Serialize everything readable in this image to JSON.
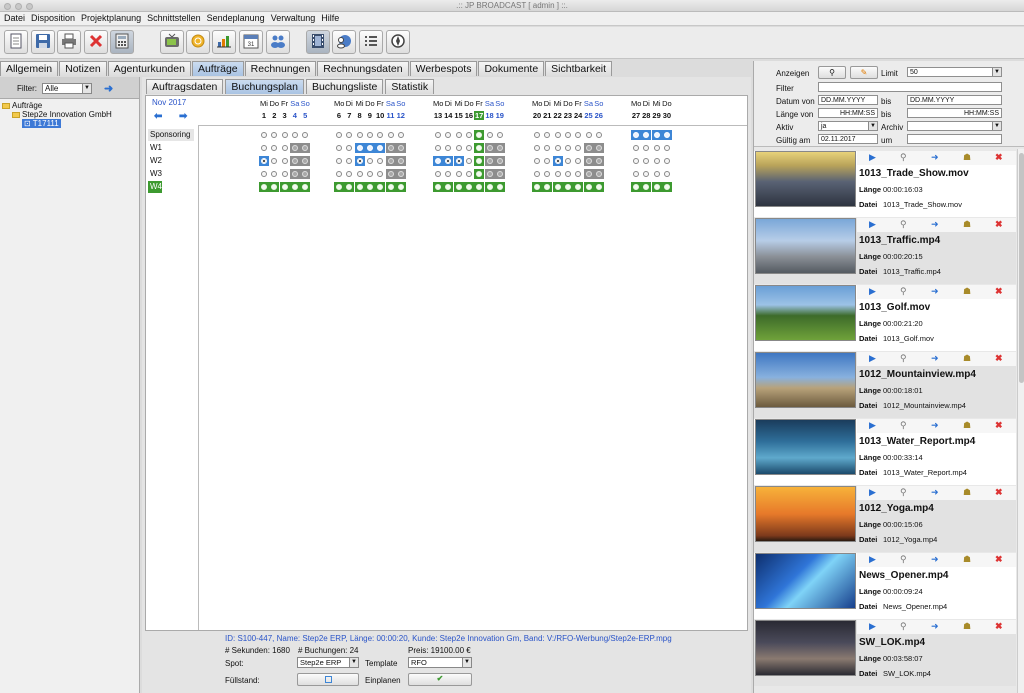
{
  "window": {
    "title": ".:: JP BROADCAST [ admin ] ::."
  },
  "menu": [
    "Datei",
    "Disposition",
    "Projektplanung",
    "Schnittstellen",
    "Sendeplanung",
    "Verwaltung",
    "Hilfe"
  ],
  "toolbar": {
    "buttons": [
      "new-document",
      "save",
      "print",
      "delete",
      "calculator",
      "tv",
      "coins",
      "chart",
      "calendar",
      "users",
      "film",
      "globe-user",
      "list",
      "compass"
    ],
    "active": [
      "calculator",
      "film"
    ]
  },
  "main_tabs": [
    "Allgemein",
    "Notizen",
    "Agenturkunden",
    "Aufträge",
    "Rechnungen",
    "Rechnungsdaten",
    "Werbespots",
    "Dokumente",
    "Sichtbarkeit"
  ],
  "main_tab_active": "Aufträge",
  "left": {
    "filter_label": "Filter:",
    "filter_value": "Alle",
    "tree": {
      "root": "Aufträge",
      "customer": "Step2e Innovation GmbH",
      "order": "T17111"
    }
  },
  "sub_tabs": [
    "Auftragsdaten",
    "Buchungsplan",
    "Buchungsliste",
    "Statistik"
  ],
  "sub_tab_active": "Buchungsplan",
  "plan": {
    "month": "Nov 2017",
    "rows": [
      "Sponsoring",
      "W1",
      "W2",
      "W3",
      "W4"
    ],
    "today": "17",
    "weeks": [
      {
        "days": [
          [
            "Mi",
            "1"
          ],
          [
            "Do",
            "2"
          ],
          [
            "Fr",
            "3"
          ],
          [
            "Sa",
            "4"
          ],
          [
            "So",
            "5"
          ]
        ],
        "cells": [
          "wwwww",
          "wwwgg",
          "bwwgg",
          "wwwgg",
          "GGGGG"
        ],
        "sel": [
          [
            2,
            0
          ]
        ]
      },
      {
        "days": [
          [
            "Mo",
            "6"
          ],
          [
            "Di",
            "7"
          ],
          [
            "Mi",
            "8"
          ],
          [
            "Do",
            "9"
          ],
          [
            "Fr",
            "10"
          ],
          [
            "Sa",
            "11"
          ],
          [
            "So",
            "12"
          ]
        ],
        "cells": [
          "wwwwwww",
          "wwbbbgg",
          "wwbwwgg",
          "wwwwwgg",
          "GGGGGGG"
        ],
        "sel": [
          [
            2,
            2
          ]
        ]
      },
      {
        "days": [
          [
            "Mo",
            "13"
          ],
          [
            "Di",
            "14"
          ],
          [
            "Mi",
            "15"
          ],
          [
            "Do",
            "16"
          ],
          [
            "Fr",
            "17"
          ],
          [
            "Sa",
            "18"
          ],
          [
            "So",
            "19"
          ]
        ],
        "cells": [
          "wwwwGww",
          "wwwwGgg",
          "bbbwGgg",
          "wwwwGgg",
          "GGGGGGG"
        ],
        "sel": [
          [
            2,
            1
          ],
          [
            2,
            2
          ]
        ]
      },
      {
        "days": [
          [
            "Mo",
            "20"
          ],
          [
            "Di",
            "21"
          ],
          [
            "Mi",
            "22"
          ],
          [
            "Do",
            "23"
          ],
          [
            "Fr",
            "24"
          ],
          [
            "Sa",
            "25"
          ],
          [
            "So",
            "26"
          ]
        ],
        "cells": [
          "wwwwwww",
          "wwwwwgg",
          "wwbwwgg",
          "wwwwwgg",
          "GGGGGGG"
        ],
        "sel": [
          [
            2,
            2
          ]
        ]
      },
      {
        "days": [
          [
            "Mo",
            "27"
          ],
          [
            "Di",
            "28"
          ],
          [
            "Mi",
            "29"
          ],
          [
            "Do",
            "30"
          ]
        ],
        "cells": [
          "bbbb",
          "wwww",
          "wwww",
          "wwww",
          "GGGG"
        ],
        "sel": []
      }
    ]
  },
  "info": {
    "id_line": "ID: S100-447, Name: Step2e ERP, Länge: 00:00:20, Kunde: Step2e Innovation Gm, Band: V:/RFO-Werbung/Step2e-ERP.mpg",
    "sekunden": "# Sekunden: 1680",
    "buchungen": "# Buchungen: 24",
    "preis": "Preis: 19100.00 €",
    "spot_label": "Spot:",
    "spot_value": "Step2e ERP",
    "template_label": "Template",
    "template_value": "RFO",
    "fullstand_label": "Füllstand:",
    "einplanen_label": "Einplanen"
  },
  "form": {
    "anzeigen_label": "Anzeigen",
    "limit_label": "Limit",
    "limit_value": "50",
    "filter_label": "Filter",
    "datum_von_label": "Datum von",
    "datum_von_value": "DD.MM.YYYY",
    "bis_label": "bis",
    "datum_bis_value": "DD.MM.YYYY",
    "laenge_von_label": "Länge von",
    "laenge_von_value": "HH:MM:SS",
    "laenge_bis_value": "HH:MM:SS",
    "aktiv_label": "Aktiv",
    "aktiv_value": "ja",
    "archiv_label": "Archiv",
    "gueltig_label": "Gültig am",
    "gueltig_value": "02.11.2017",
    "um_label": "um"
  },
  "media_labels": {
    "laenge": "Länge",
    "datei": "Datei"
  },
  "media": [
    {
      "title": "1013_Trade_Show.mov",
      "length": "00:00:16:03",
      "file": "1013_Trade_Show.mov",
      "thumb": "trade-show"
    },
    {
      "title": "1013_Traffic.mp4",
      "length": "00:00:20:15",
      "file": "1013_Traffic.mp4",
      "thumb": "traffic"
    },
    {
      "title": "1013_Golf.mov",
      "length": "00:00:21:20",
      "file": "1013_Golf.mov",
      "thumb": "golf"
    },
    {
      "title": "1012_Mountainview.mp4",
      "length": "00:00:18:01",
      "file": "1012_Mountainview.mp4",
      "thumb": "mountain"
    },
    {
      "title": "1013_Water_Report.mp4",
      "length": "00:00:33:14",
      "file": "1013_Water_Report.mp4",
      "thumb": "water"
    },
    {
      "title": "1012_Yoga.mp4",
      "length": "00:00:15:06",
      "file": "1012_Yoga.mp4",
      "thumb": "yoga"
    },
    {
      "title": "News_Opener.mp4",
      "length": "00:00:09:24",
      "file": "News_Opener.mp4",
      "thumb": "news"
    },
    {
      "title": "SW_LOK.mp4",
      "length": "00:03:58:07",
      "file": "SW_LOK.mp4",
      "thumb": "anchor"
    }
  ]
}
